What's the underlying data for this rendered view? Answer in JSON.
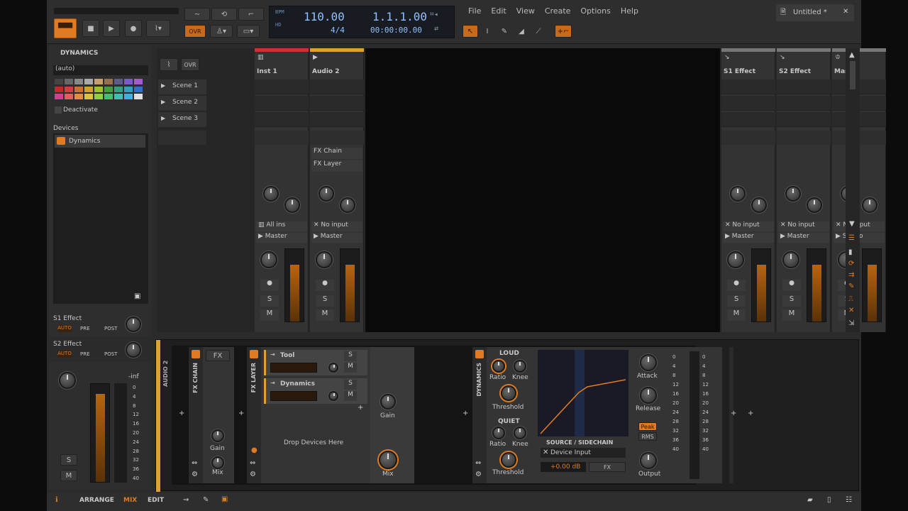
{
  "menu": [
    "File",
    "Edit",
    "View",
    "Create",
    "Options",
    "Help"
  ],
  "doc_tab": "Untitled *",
  "transport": {
    "tempo": "110.00",
    "signature": "4/4",
    "position": "1.1.1.00",
    "time": "00:00:00.00",
    "bpm_label": "BPM",
    "hd_label": "HD",
    "ovr": "OVR"
  },
  "inspector": {
    "title": "DYNAMICS",
    "auto": "(auto)",
    "deactivate": "Deactivate",
    "devices_label": "Devices",
    "device": "Dynamics",
    "sends": [
      {
        "name": "S1 Effect",
        "a": "AUTO",
        "b": "PRE",
        "c": "POST"
      },
      {
        "name": "S2 Effect",
        "a": "AUTO",
        "b": "PRE",
        "c": "POST"
      }
    ],
    "level": "-inf",
    "scale": [
      "0",
      "4",
      "8",
      "12",
      "16",
      "20",
      "24",
      "28",
      "32",
      "36",
      "40"
    ],
    "s": "S",
    "m": "M"
  },
  "palette": [
    "#444",
    "#666",
    "#888",
    "#aaa",
    "#c8a070",
    "#9a6f4d",
    "#5c5c8c",
    "#7a5ac8",
    "#a45ad0",
    "#c02a2a",
    "#d04040",
    "#d07030",
    "#d0a030",
    "#a0c030",
    "#40a040",
    "#30a080",
    "#30a0c0",
    "#3070d0",
    "#d04090",
    "#e06060",
    "#e09040",
    "#e0c040",
    "#90d040",
    "#40c070",
    "#40c0b0",
    "#40b0e0",
    "#e0e0e0"
  ],
  "mixer": {
    "scenes": [
      "Scene 1",
      "Scene 2",
      "Scene 3"
    ],
    "ovr": "OVR",
    "tracks": [
      {
        "name": "Inst 1",
        "color": "#d03030",
        "input": "All ins",
        "output": "Master",
        "clips": []
      },
      {
        "name": "Audio 2",
        "color": "#e0a030",
        "input": "No input",
        "output": "Master",
        "clips": [
          "FX Chain",
          "FX Layer"
        ]
      }
    ],
    "fx_tracks": [
      {
        "name": "S1 Effect",
        "input": "No input",
        "output": "Master"
      },
      {
        "name": "S2 Effect",
        "input": "No input",
        "output": "Master"
      },
      {
        "name": "Master",
        "input": "No input",
        "output": "Studio"
      }
    ],
    "s": "S",
    "m": "M"
  },
  "device_panel": {
    "track_label": "AUDIO 2",
    "fx_chain": "FX CHAIN",
    "fx": "FX",
    "gain": "Gain",
    "mix": "Mix",
    "fx_layer": "FX LAYER",
    "layers": [
      {
        "name": "Tool"
      },
      {
        "name": "Dynamics"
      }
    ],
    "s": "S",
    "m": "M",
    "drop": "Drop Devices Here",
    "layer_gain": "Gain",
    "layer_mix": "Mix",
    "dynamics": {
      "title": "DYNAMICS",
      "loud": "LOUD",
      "quiet": "QUIET",
      "ratio": "Ratio",
      "knee": "Knee",
      "threshold": "Threshold",
      "source": "SOURCE / SIDECHAIN",
      "device_input": "Device Input",
      "db": "+0.00 dB",
      "fx": "FX",
      "attack": "Attack",
      "release": "Release",
      "peak": "Peak",
      "rms": "RMS",
      "output": "Output",
      "scale": [
        "0",
        "4",
        "8",
        "12",
        "16",
        "20",
        "24",
        "28",
        "32",
        "36",
        "40"
      ]
    }
  },
  "bottom": {
    "arrange": "ARRANGE",
    "mix": "MIX",
    "edit": "EDIT"
  }
}
